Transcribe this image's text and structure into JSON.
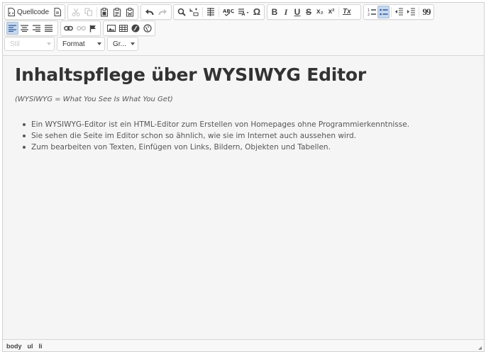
{
  "toolbar": {
    "source_label": "Quellcode",
    "style_combo": "Stil",
    "format_combo": "Format",
    "size_combo": "Gr...",
    "icons": [
      "source-icon",
      "template-icon",
      "cut-icon",
      "copy-icon",
      "paste-icon",
      "paste-text-icon",
      "paste-word-icon",
      "undo-icon",
      "redo-icon",
      "find-icon",
      "replace-icon",
      "select-all-icon",
      "spellcheck-icon",
      "language-icon",
      "special-char-icon",
      "bold-icon",
      "italic-icon",
      "underline-icon",
      "strike-icon",
      "subscript-icon",
      "superscript-icon",
      "remove-format-icon",
      "numbered-list-icon",
      "bulleted-list-icon",
      "outdent-icon",
      "indent-icon",
      "blockquote-icon",
      "align-left-icon",
      "align-center-icon",
      "align-right-icon",
      "justify-icon",
      "link-icon",
      "unlink-icon",
      "anchor-icon",
      "image-icon",
      "table-icon",
      "flash-icon",
      "iframe-icon"
    ],
    "glyphs": {
      "bold": "B",
      "italic": "I",
      "underline": "U",
      "strike": "S",
      "subscript": "x₂",
      "superscript": "x²",
      "remove_format": "Tx",
      "special_char": "Ω",
      "blockquote": "99"
    }
  },
  "content": {
    "heading": "Inhaltspflege über WYSIWYG Editor",
    "subtitle": "(WYSIWYG = What You See Is What You Get)",
    "bullets": [
      "Ein WYSIWYG-Editor ist ein HTML-Editor zum Erstellen von Homepages ohne Programmierkenntnisse.",
      "Sie sehen die Seite im Editor schon so ähnlich, wie sie im Internet auch aussehen wird.",
      "Zum bearbeiten von Texten, Einfügen von Links, Bildern, Objekten und Tabellen."
    ]
  },
  "statusbar": {
    "path": [
      "body",
      "ul",
      "li"
    ]
  },
  "colors": {
    "active_button": "#c8d8ed",
    "editor_bg": "#f5f5f5",
    "heading": "#333333",
    "body_text": "#555555"
  }
}
